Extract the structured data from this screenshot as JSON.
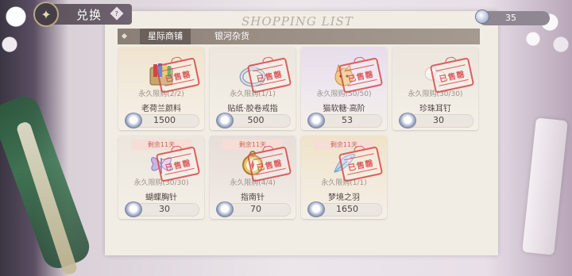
{
  "header": {
    "back_icon": "back-emblem-icon",
    "title": "兑换",
    "help_icon": "help-diamond-icon",
    "paper_heading": "SHOPPING LIST"
  },
  "currency": {
    "icon": "ring-currency-icon",
    "value": "35"
  },
  "tabs": [
    {
      "label": "星际商铺",
      "selected": true
    },
    {
      "label": "银河杂货",
      "selected": false
    }
  ],
  "sold_stamp_text": "已售罄",
  "price_icon": "ring-currency-icon",
  "items": [
    {
      "name": "老荷兰颜料",
      "limit": "永久限购(2/2)",
      "price": "1500",
      "remaining": "",
      "icon": "paint-set-icon",
      "theme": "cream"
    },
    {
      "name": "贴纸·胶卷戒指",
      "limit": "永久限购(1/1)",
      "price": "500",
      "remaining": "",
      "icon": "film-ring-icon",
      "theme": "neutral"
    },
    {
      "name": "猫软糖·高阶",
      "limit": "永久限购(50/50)",
      "price": "53",
      "remaining": "",
      "icon": "cat-candy-icon",
      "theme": "purple"
    },
    {
      "name": "珍珠耳钉",
      "limit": "永久限购(30/30)",
      "price": "30",
      "remaining": "",
      "icon": "pearl-earring-icon",
      "theme": "neutral"
    },
    {
      "name": "蝴蝶胸针",
      "limit": "永久限购(30/30)",
      "price": "30",
      "remaining": "剩余11天",
      "icon": "butterfly-brooch-icon",
      "theme": "neutral"
    },
    {
      "name": "指南针",
      "limit": "永久限购(4/4)",
      "price": "70",
      "remaining": "剩余11天",
      "icon": "compass-icon",
      "theme": "rose"
    },
    {
      "name": "梦境之羽",
      "limit": "永久限购(1/1)",
      "price": "1650",
      "remaining": "剩余11天",
      "icon": "dream-feather-icon",
      "theme": "amber"
    }
  ],
  "colors": {
    "stamp_red": "#d9474a",
    "tab_bar": "#9a8e85",
    "remaining_tag_bg": "#f6ddd5",
    "remaining_tag_text": "#c4695b"
  }
}
